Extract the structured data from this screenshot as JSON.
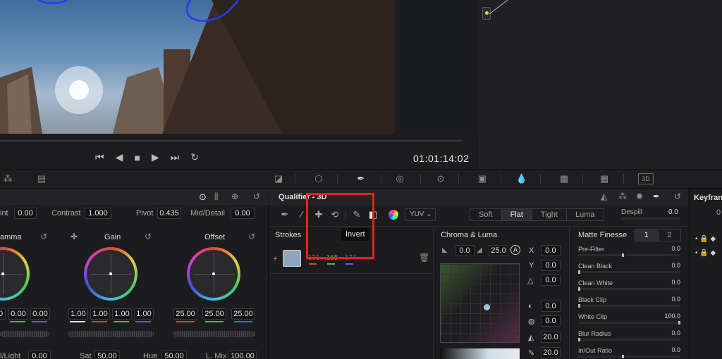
{
  "viewer": {
    "timecode": "01:01:14:02",
    "transport": [
      "⏮",
      "◀",
      "■",
      "▶",
      "⏭",
      "↻"
    ]
  },
  "primaries": {
    "top_row": {
      "int_label": "int",
      "int_value": "0.00",
      "contrast_label": "Contrast",
      "contrast_value": "1.000",
      "pivot_label": "Pivot",
      "pivot_value": "0.435",
      "middetail_label": "Mid/Detail",
      "middetail_value": "0.00"
    },
    "wheels": [
      {
        "title": "amma",
        "values": [
          "0",
          "0.00",
          "0.00"
        ]
      },
      {
        "title": "Gain",
        "values": [
          "1.00",
          "1.00",
          "1.00",
          "1.00"
        ]
      },
      {
        "title": "Offset",
        "values": [
          "25.00",
          "25.00",
          "25.00"
        ]
      }
    ],
    "bottom_row": {
      "light_label": "l/Light",
      "light_value": "0.00",
      "sat_label": "Sat",
      "sat_value": "50.00",
      "hue_label": "Hue",
      "hue_value": "50.00",
      "lmix_label": "L. Mix",
      "lmix_value": "100.00"
    }
  },
  "qualifier": {
    "title": "Qualifier - 3D",
    "colorspace": "YUV",
    "modes": [
      "Soft",
      "Flat",
      "Tight",
      "Luma"
    ],
    "active_mode": "Flat",
    "despill_label": "Despill",
    "despill_value": "0.0",
    "tooltip": "Invert",
    "strokes": {
      "title": "Strokes",
      "values": [
        ".131",
        ".155",
        ".174"
      ]
    },
    "chroma": {
      "title": "Chroma & Luma",
      "top_values": [
        "0.0",
        "25.0"
      ],
      "xyz": [
        {
          "label": "X",
          "value": "0.0"
        },
        {
          "label": "Y",
          "value": "0.0"
        },
        {
          "label": "",
          "value": "0.0"
        }
      ],
      "lower_values": [
        "0.0",
        "0.0",
        "20.0",
        "20.0"
      ]
    },
    "matte": {
      "title": "Matte Finesse",
      "tabs": [
        "1",
        "2"
      ],
      "rows": [
        {
          "label": "Pre-Filter",
          "value": "0.0"
        },
        {
          "label": "Clean Black",
          "value": "0.0"
        },
        {
          "label": "Clean White",
          "value": "0.0"
        },
        {
          "label": "Black Clip",
          "value": "0.0"
        },
        {
          "label": "White Clip",
          "value": "100.0"
        },
        {
          "label": "Blur Radius",
          "value": "0.0"
        },
        {
          "label": "In/Out Ratio",
          "value": "0.0"
        }
      ]
    }
  },
  "keyframes": {
    "title": "Keyfran",
    "value": "0"
  }
}
